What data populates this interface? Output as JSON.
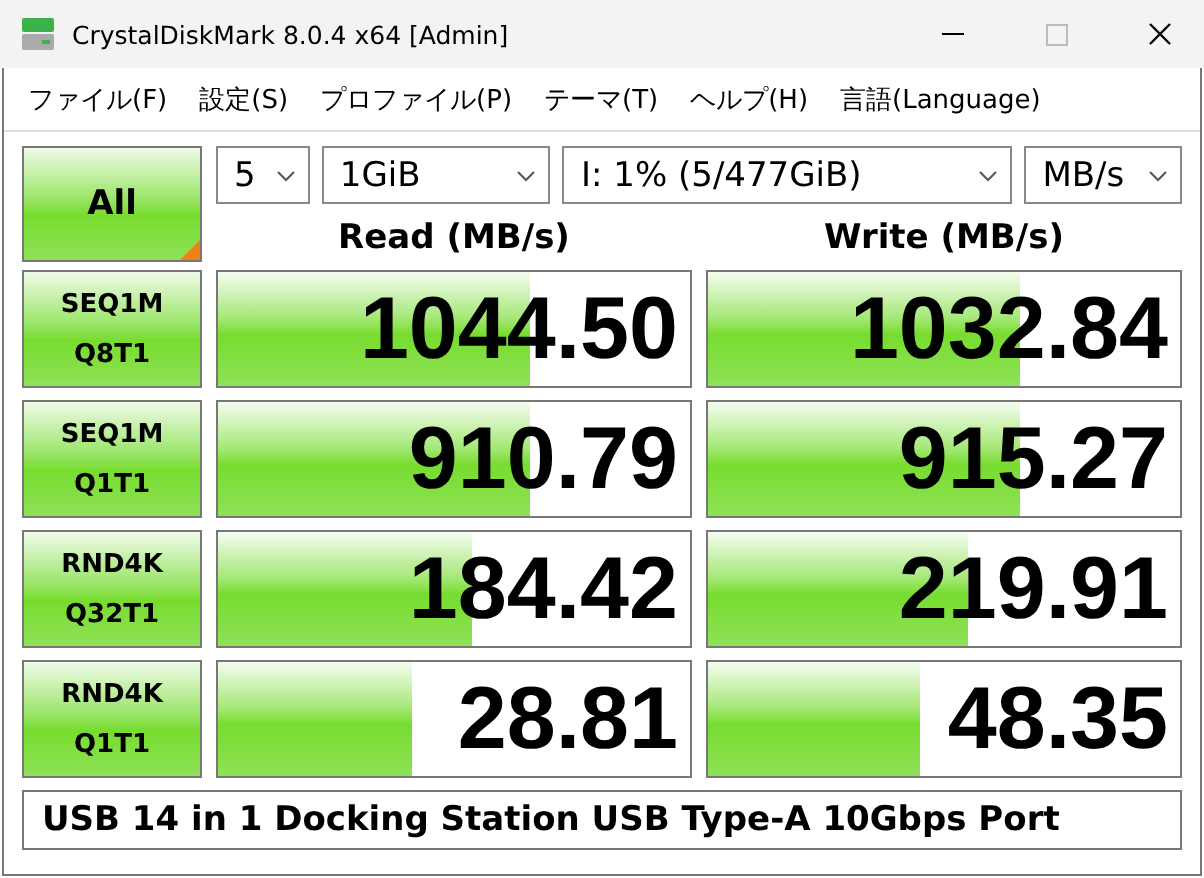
{
  "window": {
    "title": "CrystalDiskMark 8.0.4 x64 [Admin]",
    "maximize_disabled": true
  },
  "menu": [
    "ファイル(F)",
    "設定(S)",
    "プロファイル(P)",
    "テーマ(T)",
    "ヘルプ(H)",
    "言語(Language)"
  ],
  "all_button": "All",
  "selects": [
    {
      "value": "5"
    },
    {
      "value": "1GiB"
    },
    {
      "value": "I: 1% (5/477GiB)"
    },
    {
      "value": "MB/s"
    }
  ],
  "headers": {
    "read": "Read (MB/s)",
    "write": "Write (MB/s)"
  },
  "rows": [
    {
      "name": "SEQ1M",
      "params": "Q8T1",
      "read": {
        "value": "1044.50",
        "level": 0.66
      },
      "write": {
        "value": "1032.84",
        "level": 0.66
      }
    },
    {
      "name": "SEQ1M",
      "params": "Q1T1",
      "read": {
        "value": "910.79",
        "level": 0.66
      },
      "write": {
        "value": "915.27",
        "level": 0.66
      }
    },
    {
      "name": "RND4K",
      "params": "Q32T1",
      "read": {
        "value": "184.42",
        "level": 0.54
      },
      "write": {
        "value": "219.91",
        "level": 0.55
      }
    },
    {
      "name": "RND4K",
      "params": "Q1T1",
      "read": {
        "value": "28.81",
        "level": 0.41
      },
      "write": {
        "value": "48.35",
        "level": 0.45
      }
    }
  ],
  "comment": "USB 14 in 1 Docking Station USB Type-A 10Gbps Port"
}
